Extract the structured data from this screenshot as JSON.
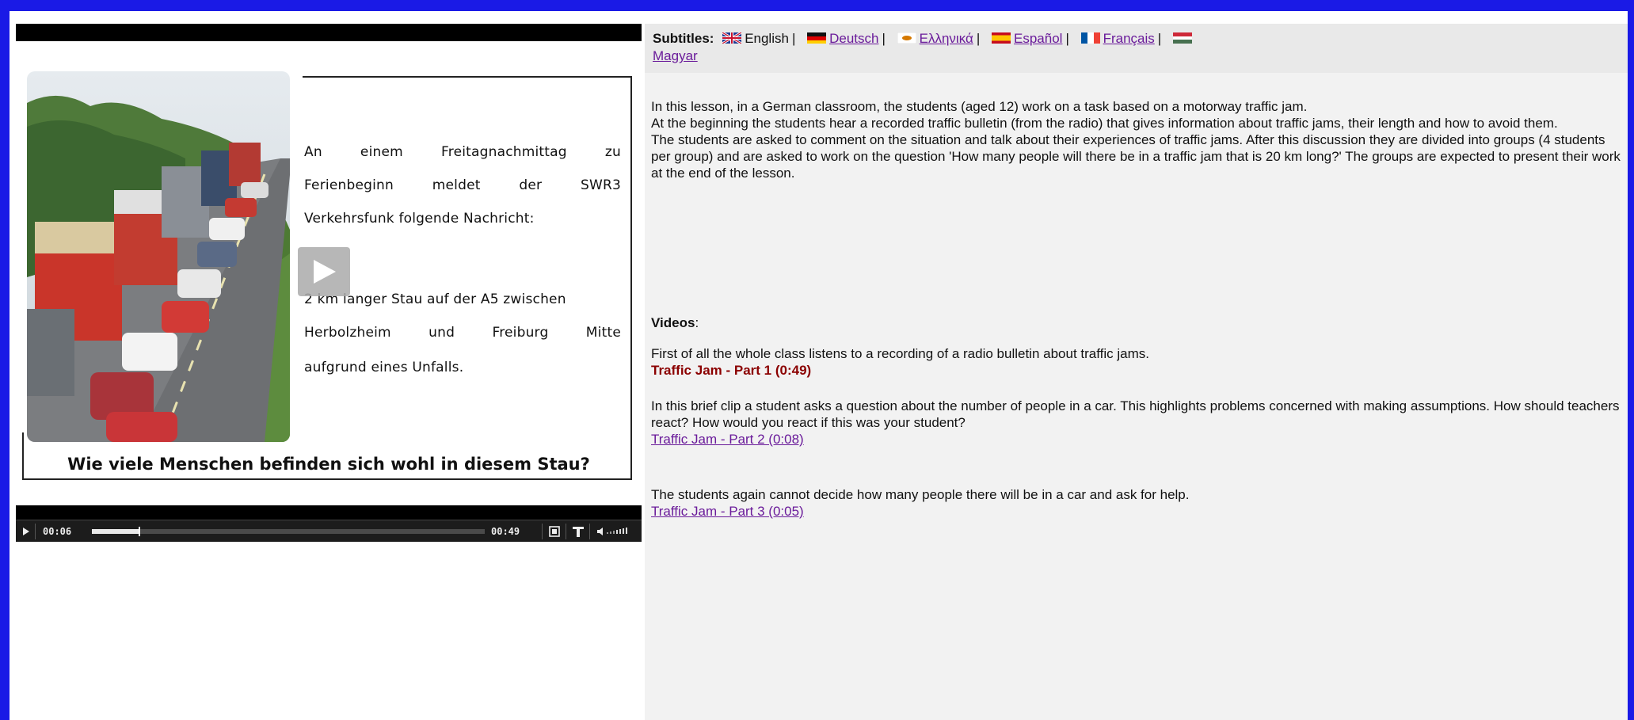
{
  "video": {
    "slide_lines": [
      "An einem Freitagnachmittag zu",
      "Ferienbeginn meldet der SWR3",
      "Verkehrsfunk folgende Nachricht:"
    ],
    "slide_lines_2": [
      "2 km langer Stau auf der A5 zwischen",
      "Herbolzheim und Freiburg Mitte",
      "aufgrund eines Unfalls."
    ],
    "slide_question": "Wie viele Menschen befinden sich wohl in diesem Stau?",
    "current_time": "00:06",
    "duration": "00:49",
    "progress": 0.12,
    "icons": [
      "play-icon",
      "fullscreen-icon",
      "captions-icon",
      "volume-icon"
    ]
  },
  "subtitles": {
    "label": "Subtitles:",
    "current": "English",
    "languages": [
      {
        "name": "Deutsch",
        "flag": "de"
      },
      {
        "name": "Ελληνικά",
        "flag": "cy"
      },
      {
        "name": "Español",
        "flag": "es"
      },
      {
        "name": "Français",
        "flag": "fr"
      },
      {
        "name": "Magyar",
        "flag": "hu"
      }
    ]
  },
  "description": [
    "In this lesson, in a German classroom, the students (aged 12) work on a task based on a motorway traffic jam.",
    "At the beginning the students hear a recorded traffic bulletin (from the radio) that gives information about traffic jams, their length and how to avoid them.",
    "The students are asked to comment on the situation and talk about their experiences of traffic jams. After this discussion they are divided into groups (4 students per group) and are asked to work on the question 'How many people will there be in a traffic jam that is 20 km long?' The groups are expected to present their work at the end of the lesson."
  ],
  "videos": {
    "heading": "Videos",
    "items": [
      {
        "text": "First of all the whole class listens to a recording of a radio bulletin about traffic jams.",
        "link": "Traffic Jam - Part 1 (0:49)"
      },
      {
        "text": "In this brief clip a student asks a question about the number of people in a car. This highlights problems concerned with making assumptions. How should teachers react? How would you react if this was your student?",
        "link": "Traffic Jam - Part 2 (0:08)"
      },
      {
        "text": "The students again cannot decide how many people there will be in a car and ask for help.",
        "link": "Traffic Jam - Part 3 (0:05)"
      }
    ]
  },
  "colors": {
    "frame": "#1a1ae6",
    "current_link": "#8b0000",
    "visited_link": "#6a1b9a"
  }
}
